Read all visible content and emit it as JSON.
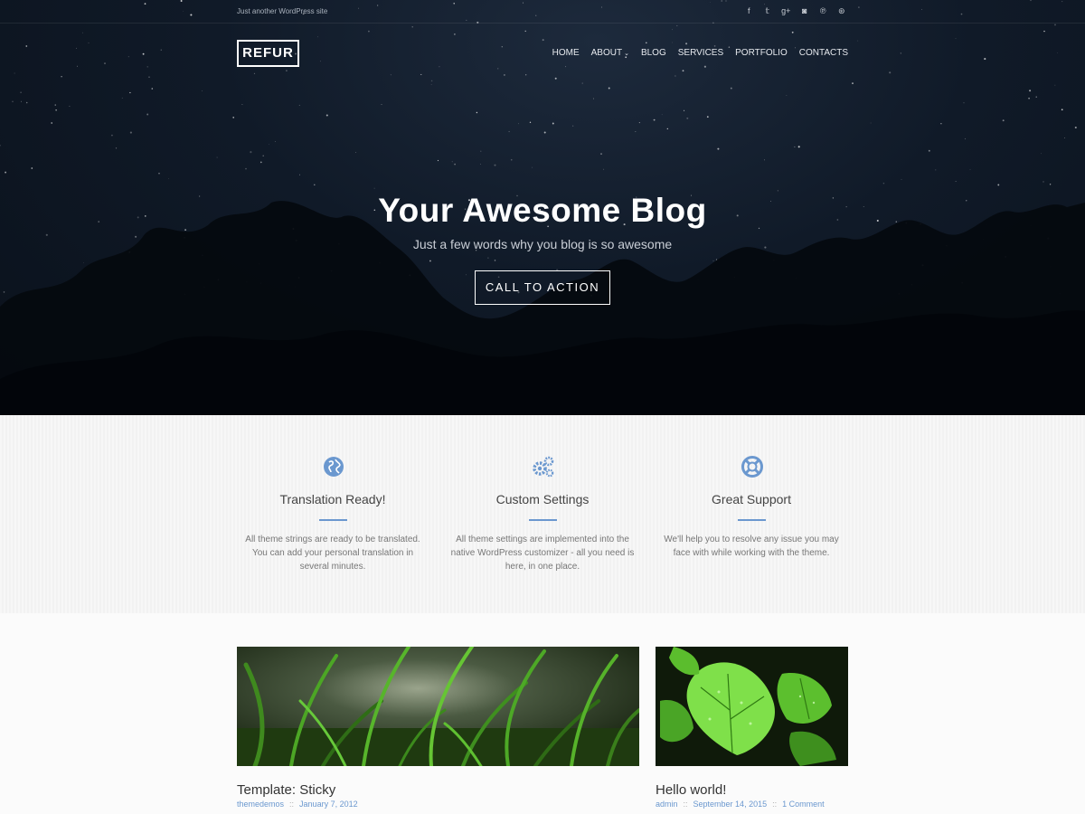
{
  "site": {
    "tagline": "Just another WordPress site",
    "logo": "REFUR"
  },
  "social": [
    "facebook-icon",
    "twitter-icon",
    "google-plus-icon",
    "instagram-icon",
    "pinterest-icon",
    "dribbble-icon"
  ],
  "social_glyphs": [
    "f",
    "𝕥",
    "g+",
    "◙",
    "℗",
    "⊛"
  ],
  "nav": [
    "HOME",
    "ABOUT",
    "BLOG",
    "SERVICES",
    "PORTFOLIO",
    "CONTACTS"
  ],
  "nav_caret": "⌄",
  "hero": {
    "title": "Your Awesome Blog",
    "subtitle": "Just a few words why you blog is so awesome",
    "cta": "CALL TO ACTION"
  },
  "features": [
    {
      "icon": "globe-icon",
      "title": "Translation Ready!",
      "text": "All theme strings are ready to be translated. You can add your personal translation in several minutes."
    },
    {
      "icon": "gears-icon",
      "title": "Custom Settings",
      "text": "All theme settings are implemented into the native WordPress customizer - all you need is here, in one place."
    },
    {
      "icon": "lifebuoy-icon",
      "title": "Great Support",
      "text": "We'll help you to resolve any issue you may face with while working with the theme."
    }
  ],
  "posts": [
    {
      "title": "Template: Sticky",
      "author": "themedemos",
      "date": "January 7, 2012",
      "comments": ""
    },
    {
      "title": "Hello world!",
      "author": "admin",
      "date": "September 14, 2015",
      "comments": "1 Comment"
    }
  ],
  "meta_separator": "::",
  "colors": {
    "accent": "#6b98cf",
    "hero_bg": "#101a28"
  }
}
